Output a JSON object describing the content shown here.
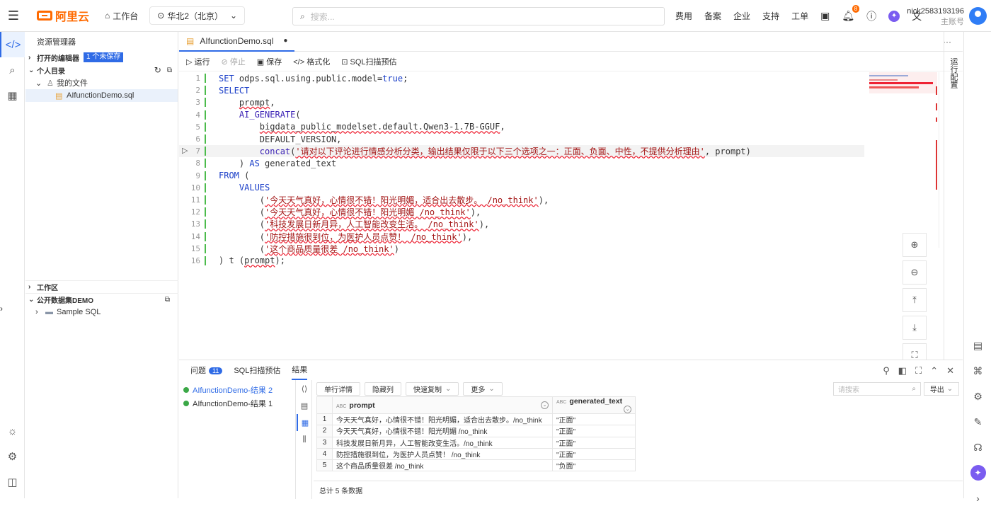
{
  "topbar": {
    "logo_text": "阿里云",
    "workbench": "工作台",
    "region": "华北2（北京）",
    "search_placeholder": "搜索...",
    "nav": [
      "费用",
      "备案",
      "企业",
      "支持",
      "工单"
    ],
    "notification_count": "8",
    "account_name": "nick2583193196",
    "account_role": "主账号"
  },
  "explorer": {
    "title": "资源管理器",
    "open_editors": "打开的编辑器",
    "unsaved": "1 个未保存",
    "personal": "个人目录",
    "my_files": "我的文件",
    "file": "AIfunctionDemo.sql",
    "workspace": "工作区",
    "public_dataset": "公开数据集DEMO",
    "sample": "Sample SQL"
  },
  "editor": {
    "tab_name": "AIfunctionDemo.sql",
    "toolbar": {
      "run": "运行",
      "stop": "停止",
      "save": "保存",
      "format": "格式化",
      "scan": "SQL扫描预估"
    },
    "right_panel": "运行配置",
    "lines": [
      [
        [
          "kw",
          "SET "
        ],
        [
          "",
          "odps.sql.using.public.model="
        ],
        [
          "kw",
          "true"
        ],
        [
          "",
          ";"
        ]
      ],
      [
        [
          "kw",
          "SELECT"
        ]
      ],
      [
        [
          "",
          "    "
        ],
        [
          "sq",
          "prompt"
        ],
        [
          "",
          ","
        ]
      ],
      [
        [
          "",
          "    "
        ],
        [
          "fn",
          "AI_GENERATE"
        ],
        [
          "",
          "("
        ]
      ],
      [
        [
          "",
          "        "
        ],
        [
          "sq",
          "bigdata_public_modelset.default.Qwen3-1.7B-GGUF"
        ],
        [
          "",
          ","
        ]
      ],
      [
        [
          "",
          "        DEFAULT_VERSION,"
        ]
      ],
      [
        [
          "",
          "        "
        ],
        [
          "fn",
          "concat"
        ],
        [
          "",
          "("
        ],
        [
          "st sq",
          "'请对以下评论进行情感分析分类，输出结果仅限于以下三个选项之一：正面、负面、中性，不提供分析理由'"
        ],
        [
          "",
          ", prompt)"
        ]
      ],
      [
        [
          "",
          "    ) "
        ],
        [
          "kw",
          "AS"
        ],
        [
          "",
          " generated_text"
        ]
      ],
      [
        [
          "kw",
          "FROM"
        ],
        [
          "",
          " ("
        ]
      ],
      [
        [
          "",
          "    "
        ],
        [
          "kw",
          "VALUES"
        ]
      ],
      [
        [
          "",
          "        ("
        ],
        [
          "st sq",
          "'今天天气真好，心情很不错！阳光明媚，适合出去散步。 /no_think'"
        ],
        [
          "",
          "),"
        ]
      ],
      [
        [
          "",
          "        ("
        ],
        [
          "st sq",
          "'今天天气真好，心情很不错！阳光明媚 /no_think'"
        ],
        [
          "",
          "),"
        ]
      ],
      [
        [
          "",
          "        ("
        ],
        [
          "st sq",
          "'科技发展日新月异，人工智能改变生活。 /no_think'"
        ],
        [
          "",
          "),"
        ]
      ],
      [
        [
          "",
          "        ("
        ],
        [
          "st sq",
          "'防控措施很到位，为医护人员点赞！ /no_think'"
        ],
        [
          "",
          "),"
        ]
      ],
      [
        [
          "",
          "        ("
        ],
        [
          "st sq",
          "'这个商品质量很差 /no_think'"
        ],
        [
          "",
          ")"
        ]
      ],
      [
        [
          "",
          ") t ("
        ],
        [
          "sq",
          "prompt"
        ],
        [
          "",
          ");"
        ]
      ]
    ]
  },
  "bottom": {
    "tabs": {
      "problems": "问题",
      "problems_count": "11",
      "scan": "SQL扫描预估",
      "results": "结果"
    },
    "result_sets": [
      "AIfunctionDemo-结果 2",
      "AIfunctionDemo-结果 1"
    ],
    "grid_buttons": [
      "单行详情",
      "隐藏列",
      "快速复制",
      "更多"
    ],
    "search_placeholder": "请搜索",
    "export": "导出",
    "columns": [
      "prompt",
      "generated_text"
    ],
    "type_tag": "ABC",
    "rows": [
      [
        "1",
        "今天天气真好，心情很不错！阳光明媚，适合出去散步。/no_think",
        "\"正面\""
      ],
      [
        "2",
        "今天天气真好，心情很不错！阳光明媚 /no_think",
        "\"正面\""
      ],
      [
        "3",
        "科技发展日新月异，人工智能改变生活。/no_think",
        "\"正面\""
      ],
      [
        "4",
        "防控措施很到位，为医护人员点赞！ /no_think",
        "\"正面\""
      ],
      [
        "5",
        "这个商品质量很差 /no_think",
        "\"负面\""
      ]
    ],
    "footer": "总计 5 条数据"
  }
}
